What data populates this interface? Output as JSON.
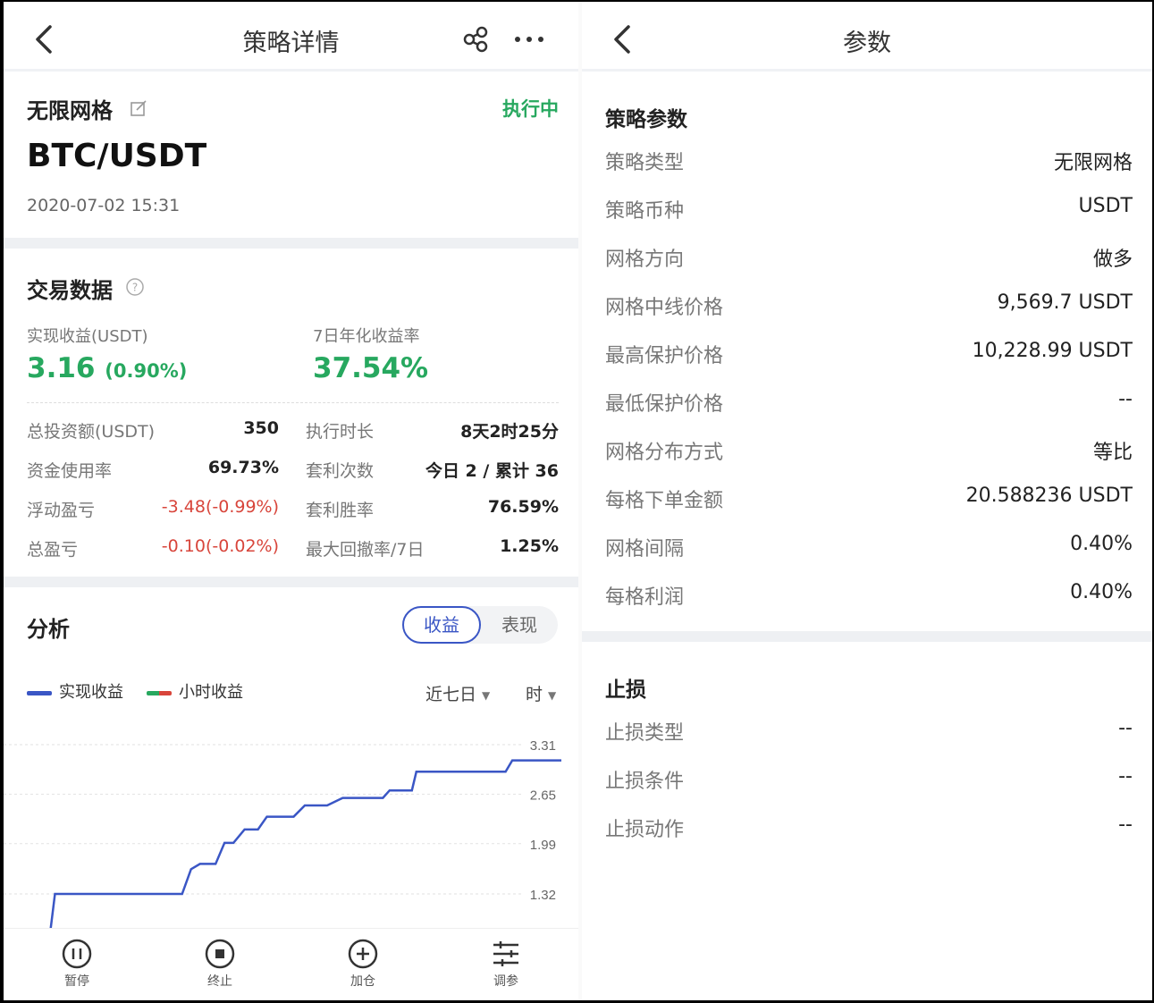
{
  "left": {
    "nav": {
      "title": "策略详情"
    },
    "strategy": {
      "name": "无限网格",
      "status": "执行中",
      "pair": "BTC/USDT",
      "date": "2020-07-02 15:31"
    },
    "trade": {
      "title": "交易数据",
      "realized_label": "实现收益(USDT)",
      "realized_value": "3.16",
      "realized_pct": "(0.90%)",
      "annual_label": "7日年化收益率",
      "annual_value": "37.54%",
      "stats_left": [
        {
          "label": "总投资额(USDT)",
          "value": "350",
          "negative": false
        },
        {
          "label": "资金使用率",
          "value": "69.73%",
          "negative": false
        },
        {
          "label": "浮动盈亏",
          "value": "-3.48(-0.99%)",
          "negative": true
        },
        {
          "label": "总盈亏",
          "value": "-0.10(-0.02%)",
          "negative": true
        }
      ],
      "stats_right": [
        {
          "label": "执行时长",
          "value": "8天2时25分"
        },
        {
          "label": "套利次数",
          "value": "今日 2 / 累计 36"
        },
        {
          "label": "套利胜率",
          "value": "76.59%"
        },
        {
          "label": "最大回撤率/7日",
          "value": "1.25%"
        }
      ]
    },
    "analysis": {
      "title": "分析",
      "toggle_on": "收益",
      "toggle_off": "表现",
      "legend": [
        {
          "name": "实现收益",
          "color": "#3a56c5"
        },
        {
          "name": "小时收益",
          "color": "#27a85f"
        }
      ],
      "range": "近七日",
      "unit": "时"
    },
    "tabs": [
      {
        "icon": "pause-icon",
        "label": "暂停"
      },
      {
        "icon": "stop-icon",
        "label": "终止"
      },
      {
        "icon": "add-icon",
        "label": "加仓"
      },
      {
        "icon": "adjust-icon",
        "label": "调参"
      }
    ]
  },
  "right": {
    "nav": {
      "title": "参数"
    },
    "params": {
      "title": "策略参数",
      "rows": [
        {
          "label": "策略类型",
          "value": "无限网格"
        },
        {
          "label": "策略币种",
          "value": "USDT"
        },
        {
          "label": "网格方向",
          "value": "做多"
        },
        {
          "label": "网格中线价格",
          "value": "9,569.7 USDT"
        },
        {
          "label": "最高保护价格",
          "value": "10,228.99 USDT"
        },
        {
          "label": "最低保护价格",
          "value": "--"
        },
        {
          "label": "网格分布方式",
          "value": "等比"
        },
        {
          "label": "每格下单金额",
          "value": "20.588236 USDT"
        },
        {
          "label": "网格间隔",
          "value": "0.40%"
        },
        {
          "label": "每格利润",
          "value": "0.40%"
        }
      ]
    },
    "stoploss": {
      "title": "止损",
      "rows": [
        {
          "label": "止损类型",
          "value": "--"
        },
        {
          "label": "止损条件",
          "value": "--"
        },
        {
          "label": "止损动作",
          "value": "--"
        }
      ]
    }
  },
  "colors": {
    "accent": "#3a56c5",
    "green": "#27a85f",
    "red": "#d8453b"
  },
  "chart_data": {
    "type": "line",
    "y_ticks": [
      "3.31",
      "2.65",
      "1.99",
      "1.32"
    ],
    "ylim": [
      0.5,
      3.5
    ],
    "series": [
      {
        "name": "实现收益",
        "x": [
          0,
          0.3,
          6,
          6.4,
          6.8,
          7.5,
          7.9,
          8.3,
          8.8,
          9.4,
          9.8,
          11.0,
          11.5,
          12.5,
          13.2,
          15.0,
          15.3,
          15.6,
          16.3,
          16.5,
          17.0,
          20.5,
          20.8,
          23.0
        ],
        "y": [
          0.6,
          1.32,
          1.32,
          1.65,
          1.72,
          1.72,
          2.0,
          2.0,
          2.18,
          2.18,
          2.35,
          2.35,
          2.5,
          2.5,
          2.6,
          2.6,
          2.7,
          2.7,
          2.7,
          2.95,
          2.95,
          2.95,
          3.1,
          3.1
        ]
      }
    ]
  }
}
